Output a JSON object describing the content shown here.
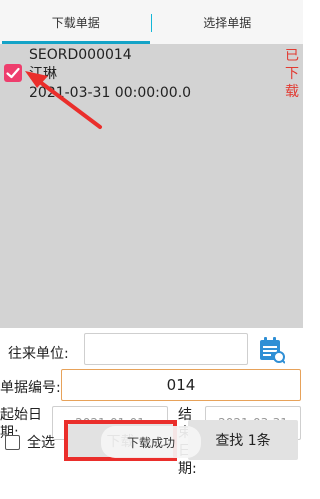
{
  "tabs": [
    {
      "label": "下载单据",
      "active": true
    },
    {
      "label": "选择单据",
      "active": false
    }
  ],
  "list": {
    "items": [
      {
        "order_no": "SEORD000014",
        "name": "江琳",
        "datetime": "2021-03-31 00:00:00.0",
        "status": "已下载",
        "checked": true
      }
    ]
  },
  "form": {
    "partner_label": "往来单位:",
    "partner_value": "",
    "doc_no_label": "单据编号:",
    "doc_no_value": "014",
    "start_label": "起始日期:",
    "start_value": "2021-01-01",
    "end_label": "结束日期:",
    "end_value": "2021-03-31"
  },
  "actions": {
    "select_all_label": "全选",
    "download_label": "下载",
    "search_label": "查找 1条"
  },
  "toast": "下载成功",
  "colors": {
    "accent": "#14a3c7",
    "checkbox": "#ee3e6d",
    "status": "#e23b32",
    "active_border": "#e7a25a",
    "highlight": "#ea2e2b"
  }
}
